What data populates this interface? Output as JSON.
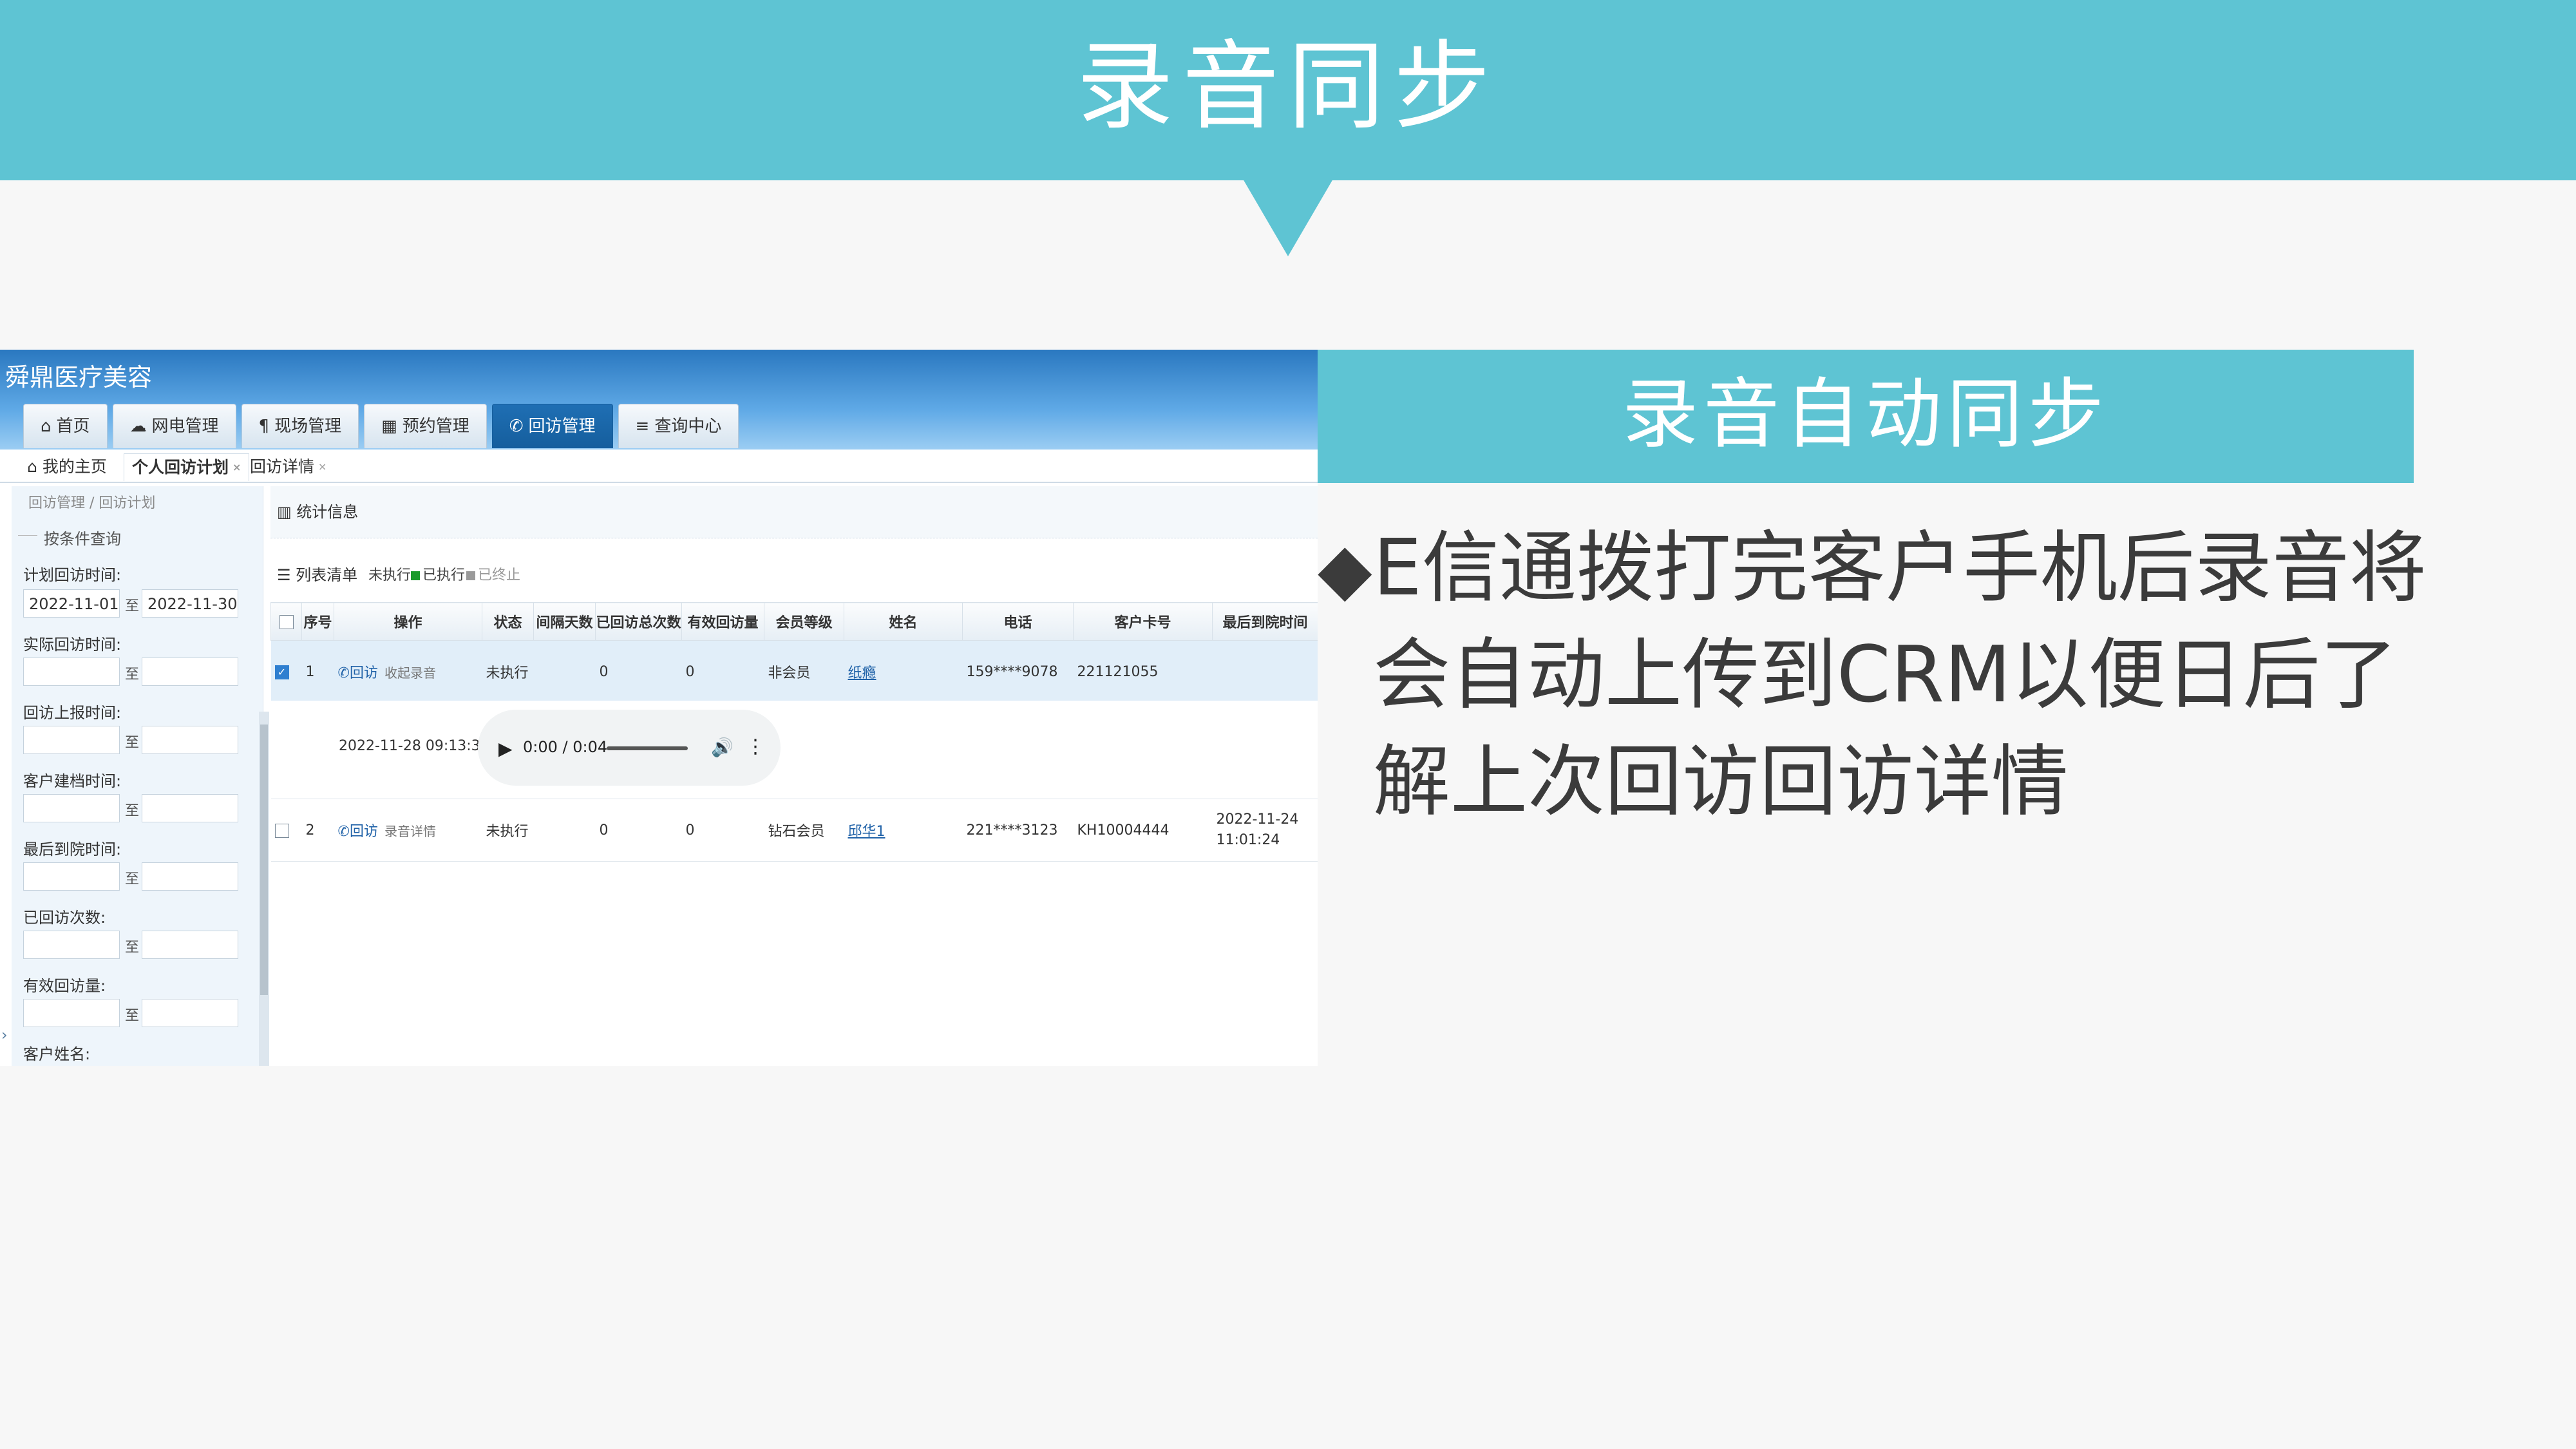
{
  "slide": {
    "title": "录音同步",
    "subtitle": "录音自动同步",
    "bullet": "◆",
    "description_lines": [
      "E信通拨打完客户手机后录音将",
      "会自动上传到CRM以便日后了",
      "解上次回访回访详情"
    ]
  },
  "app": {
    "logo": "舜鼎医疗美容",
    "nav": [
      {
        "icon": "home-icon",
        "glyph": "⌂",
        "label": "首页"
      },
      {
        "icon": "cloud-icon",
        "glyph": "☁",
        "label": "网电管理"
      },
      {
        "icon": "pilcrow-icon",
        "glyph": "¶",
        "label": "现场管理"
      },
      {
        "icon": "grid-icon",
        "glyph": "▦",
        "label": "预约管理"
      },
      {
        "icon": "phone-icon",
        "glyph": "✆",
        "label": "回访管理"
      },
      {
        "icon": "database-icon",
        "glyph": "≡",
        "label": "查询中心"
      }
    ],
    "active_nav": "回访管理",
    "subtabs": {
      "home": "我的主页",
      "plan": "个人回访计划",
      "detail": "回访详情"
    },
    "left": {
      "breadcrumb": "回访管理 / 回访计划",
      "legend": "按条件查询",
      "to": "至",
      "fields": [
        {
          "label": "计划回访时间:",
          "from": "2022-11-01",
          "to": "2022-11-30"
        },
        {
          "label": "实际回访时间:",
          "from": "",
          "to": ""
        },
        {
          "label": "回访上报时间:",
          "from": "",
          "to": ""
        },
        {
          "label": "客户建档时间:",
          "from": "",
          "to": ""
        },
        {
          "label": "最后到院时间:",
          "from": "",
          "to": ""
        },
        {
          "label": "已回访次数:",
          "from": "",
          "to": ""
        },
        {
          "label": "有效回访量:",
          "from": "",
          "to": ""
        }
      ],
      "last_label": "客户姓名:"
    },
    "main": {
      "stats_label": "统计信息",
      "list_label": "列表清单",
      "legend": [
        {
          "label": "未执行",
          "color": "#ffffff"
        },
        {
          "label": "已执行",
          "color": "#1a9a2a"
        },
        {
          "label": "已终止",
          "color": "#9a9a9a"
        }
      ],
      "columns": [
        "序号",
        "操作",
        "状态",
        "间隔天数",
        "已回访总次数",
        "有效回访量",
        "会员等级",
        "姓名",
        "电话",
        "客户卡号",
        "最后到院时间"
      ],
      "rows": [
        {
          "checked": true,
          "no": "1",
          "action": "回访",
          "action_sub": "收起录音",
          "status": "未执行",
          "interval": "",
          "total": "0",
          "valid": "0",
          "level": "非会员",
          "name": "纸瘾",
          "phone": "159****9078",
          "card": "221121055",
          "last_visit": ""
        },
        {
          "checked": false,
          "no": "2",
          "action": "回访",
          "action_sub": "录音详情",
          "status": "未执行",
          "interval": "",
          "total": "0",
          "valid": "0",
          "level": "钻石会员",
          "name": "邱华1",
          "phone": "221****3123",
          "card": "KH10004444",
          "last_visit": "2022-11-24 11:01:24"
        }
      ],
      "recording": {
        "time": "2022-11-28 09:13:39",
        "player_time": "0:00 / 0:04"
      }
    }
  },
  "colors": {
    "accent": "#5ec4d3",
    "nav_active": "#1f6fb4",
    "status": "#d000c8"
  }
}
